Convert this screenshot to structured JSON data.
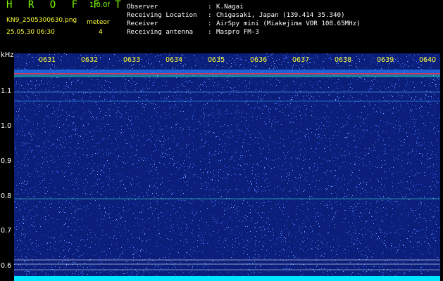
{
  "header": {
    "app_title": "H R O F F T",
    "version": "1.0.0f",
    "filename": "KN9_2505300630.png",
    "datetime": "25.05.30 06:30",
    "meteor_label": "meteor",
    "meteor_count": "4"
  },
  "info": [
    {
      "key": "Observer",
      "value": "K.Nagai"
    },
    {
      "key": "Receiving Location",
      "value": "Chigasaki, Japan (139.414 35.340)"
    },
    {
      "key": "Receiver",
      "value": "AirSpy mini (Miakejima VOR 108.65MHz)"
    },
    {
      "key": "Receiving antenna",
      "value": "Maspro FM-3"
    }
  ],
  "axis": {
    "unit": "kHz",
    "y_ticks": [
      "1.1",
      "1.0",
      "0.9",
      "0.8",
      "0.7",
      "0.6"
    ],
    "time_ticks": [
      "0631",
      "0632",
      "0633",
      "0634",
      "0635",
      "0636",
      "0637",
      "0638",
      "0639",
      "0640"
    ]
  },
  "colors": {
    "background": "#000000",
    "spectrogram_base": "#0a1e7a",
    "carrier_line": "#ff3030",
    "title_green": "#7cfc00",
    "label_yellow": "#ffff33",
    "text_white": "#ffffff"
  }
}
